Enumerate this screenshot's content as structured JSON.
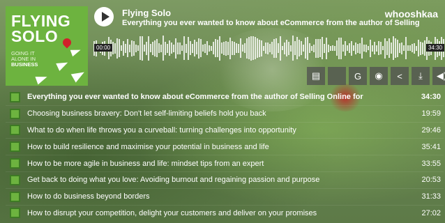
{
  "cover": {
    "line1": "FLYING",
    "line2": "SOLO",
    "sub1": "GOING IT",
    "sub2": "ALONE IN",
    "sub3": "BUSINESS"
  },
  "header": {
    "show_title": "Flying Solo",
    "episode_title": "Everything you ever wanted to know about eCommerce from the author of Selling",
    "brand": "whooshkaa"
  },
  "player": {
    "time_start": "00:00",
    "time_end": "34:30"
  },
  "actions": [
    {
      "name": "transcript-icon",
      "glyph": "▤"
    },
    {
      "name": "apple-podcasts-icon",
      "glyph": ""
    },
    {
      "name": "google-podcasts-icon",
      "glyph": "G"
    },
    {
      "name": "spotify-icon",
      "glyph": "◉"
    },
    {
      "name": "share-icon",
      "glyph": "<"
    },
    {
      "name": "download-icon",
      "glyph": "⤓"
    },
    {
      "name": "volume-icon",
      "glyph": "◀)"
    }
  ],
  "episodes": [
    {
      "title": "Everything you ever wanted to know about eCommerce from the author of Selling Online for",
      "duration": "34:30"
    },
    {
      "title": "Choosing business bravery: Don't let self-limiting beliefs hold you back",
      "duration": "19:59"
    },
    {
      "title": "What to do when life throws you a curveball: turning challenges into opportunity",
      "duration": "29:46"
    },
    {
      "title": "How to build resilience and maximise your potential in business and life",
      "duration": "35:41"
    },
    {
      "title": "How to be more agile in business and life: mindset tips from an expert",
      "duration": "33:55"
    },
    {
      "title": "Get back to doing what you love: Avoiding burnout and regaining passion and purpose",
      "duration": "20:53"
    },
    {
      "title": "How to do business beyond borders",
      "duration": "31:33"
    },
    {
      "title": "How to disrupt your competition, delight your customers and deliver on your promises",
      "duration": "27:02"
    }
  ]
}
